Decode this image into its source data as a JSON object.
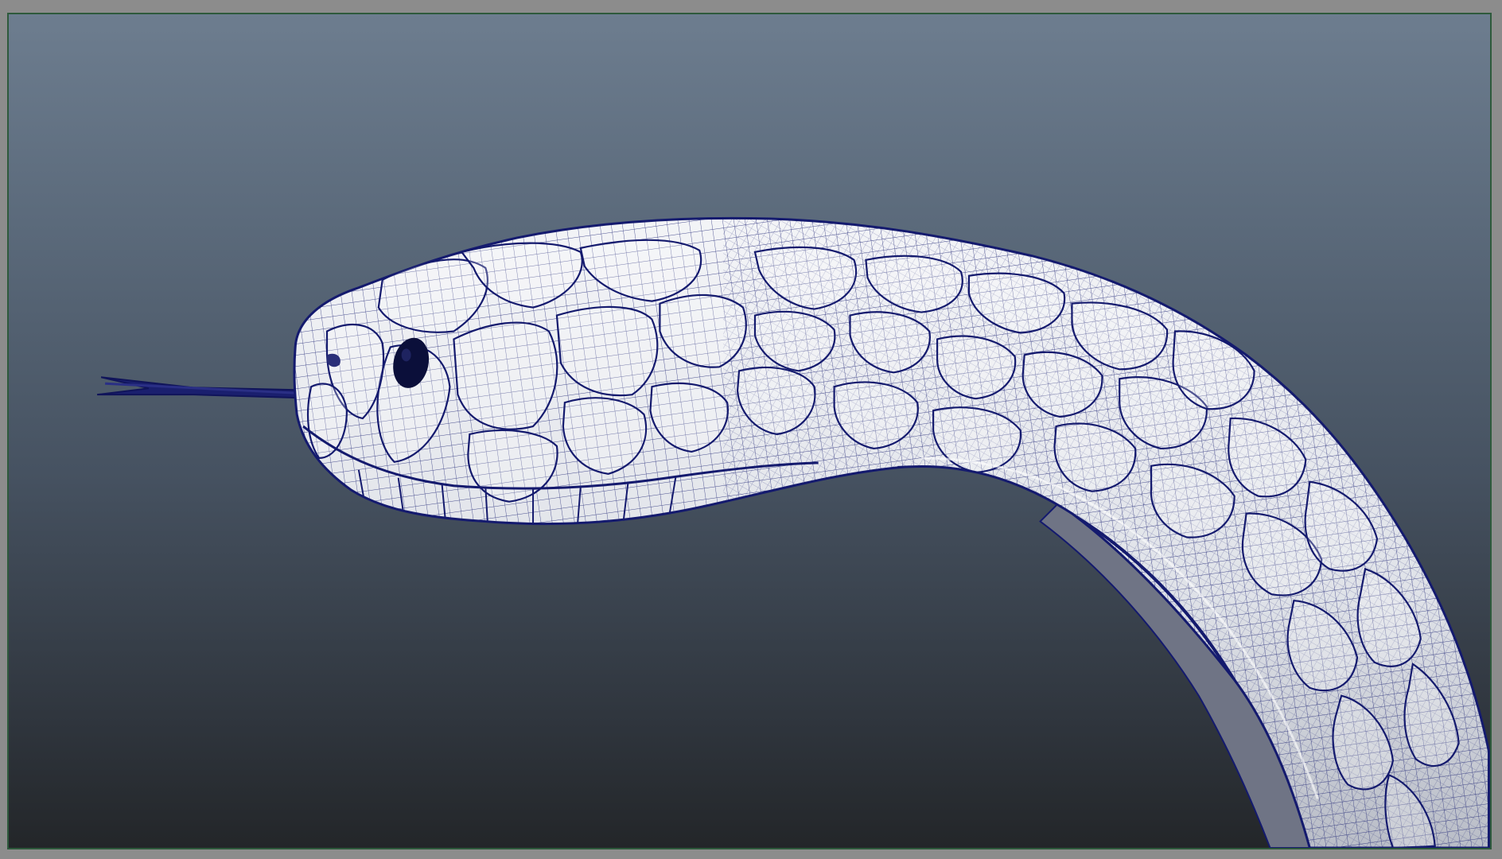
{
  "viewport": {
    "panel_name": "",
    "background_top": "#6d7d8f",
    "background_bottom": "#232629",
    "border_color": "#2e5a3c"
  },
  "model": {
    "subject": "snake-head-mesh",
    "display_mode": "wireframe-on-shaded",
    "wire_color": "#141a6e",
    "surface_color": "#e9ebf0",
    "eye_color": "#0b0f3a"
  }
}
